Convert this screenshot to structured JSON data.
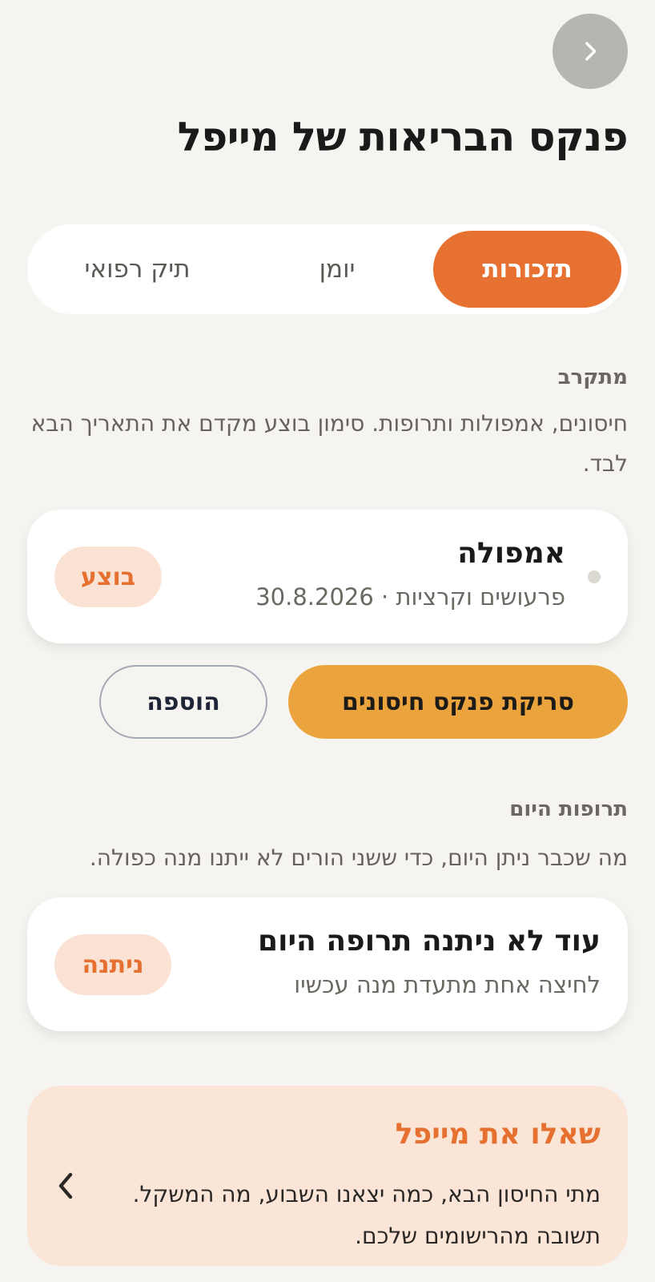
{
  "header": {
    "title": "פנקס הבריאות של מייפל",
    "back_icon": "chevron-right-icon"
  },
  "tabs": [
    {
      "label": "תזכורות",
      "active": true
    },
    {
      "label": "יומן",
      "active": false
    },
    {
      "label": "תיק רפואי",
      "active": false
    }
  ],
  "upcoming": {
    "label": "מתקרב",
    "description": "חיסונים, אמפולות ותרופות. סימון בוצע מקדם את התאריך הבא לבד.",
    "item": {
      "title": "אמפולה",
      "subtitle": "פרעושים וקרציות · 30.8.2026",
      "action_label": "בוצע"
    },
    "scan_button": "סריקת פנקס חיסונים",
    "add_button": "הוספה"
  },
  "meds_today": {
    "label": "תרופות היום",
    "description": "מה שכבר ניתן היום, כדי ששני הורים לא ייתנו מנה כפולה.",
    "item": {
      "title": "עוד לא ניתנה תרופה היום",
      "subtitle": "לחיצה אחת מתעדת מנה עכשיו",
      "action_label": "ניתנה"
    }
  },
  "ask": {
    "title": "שאלו את מייפל",
    "body": "מתי החיסון הבא, כמה יצאנו השבוע, מה המשקל. תשובה מהרישומים שלכם."
  },
  "colors": {
    "accent": "#e67130",
    "secondary": "#eba33e",
    "background": "#f6f4f1"
  }
}
